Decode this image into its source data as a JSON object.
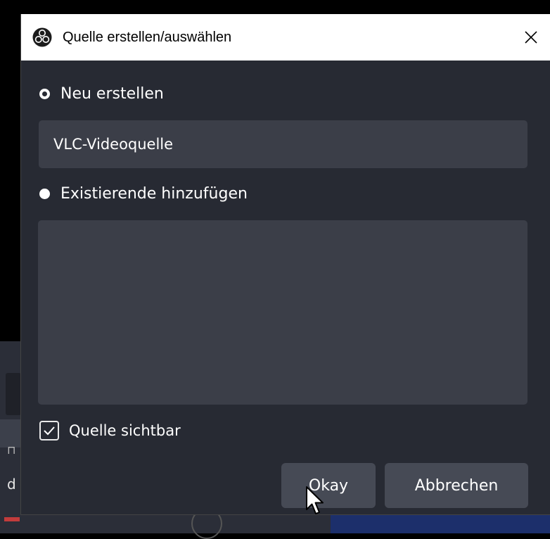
{
  "dialog": {
    "title": "Quelle erstellen/auswählen",
    "close_glyph": "✕",
    "app_icon": "obs-logo-icon",
    "create_new": {
      "label": "Neu erstellen",
      "checked": true
    },
    "name_input": {
      "value": "VLC-Videoquelle"
    },
    "add_existing": {
      "label": "Existierende hinzufügen",
      "checked": false
    },
    "existing_items": [],
    "visible_checkbox": {
      "label": "Quelle sichtbar",
      "checked": true
    },
    "buttons": {
      "ok_label": "Okay",
      "cancel_label": "Abbrechen"
    }
  },
  "background": {
    "partial_letter": "d"
  },
  "colors": {
    "dialog_bg": "#272a33",
    "field_bg": "#3b3e48",
    "button_bg": "#464a55",
    "titlebar_bg": "#ffffff",
    "accent_blue": "#1c2f6b"
  }
}
